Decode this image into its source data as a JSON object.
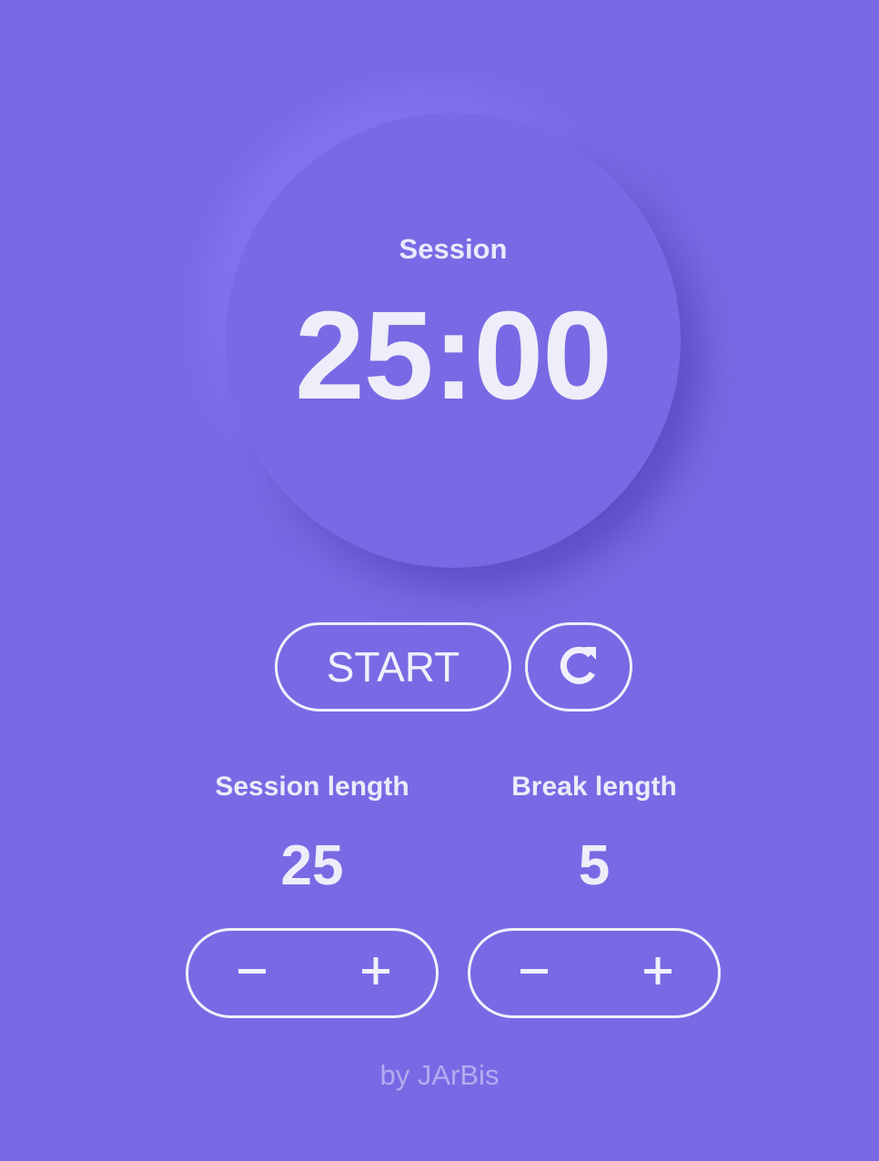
{
  "clock": {
    "mode_label": "Session",
    "time": "25:00"
  },
  "controls": {
    "start_label": "START",
    "reset_icon": "refresh-icon"
  },
  "session": {
    "label": "Session length",
    "value": "25",
    "decrement_icon": "minus-icon",
    "increment_icon": "plus-icon"
  },
  "break": {
    "label": "Break length",
    "value": "5",
    "decrement_icon": "minus-icon",
    "increment_icon": "plus-icon"
  },
  "footer": {
    "credit": "by JArBis"
  },
  "colors": {
    "background": "#786ae4",
    "foreground": "#f1f0fb",
    "muted": "#b4acf0"
  }
}
